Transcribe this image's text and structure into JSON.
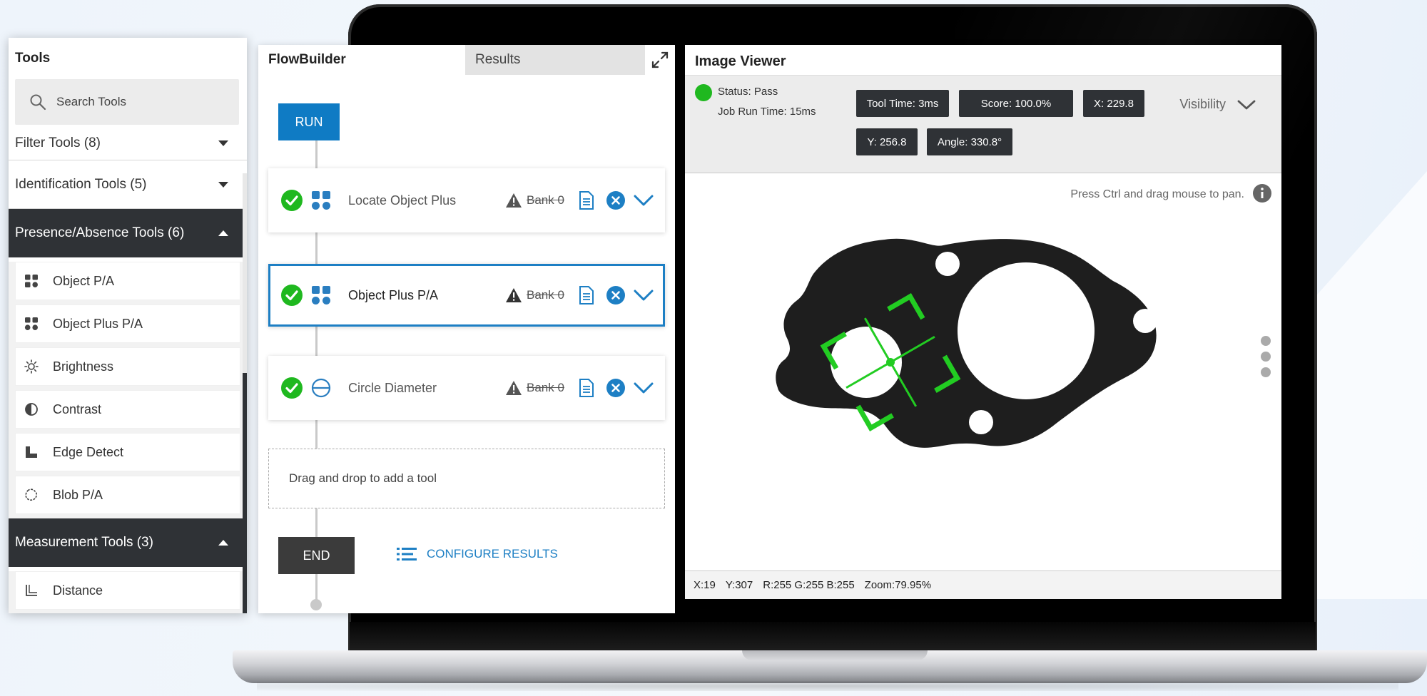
{
  "tools_panel": {
    "title": "Tools",
    "search_placeholder": "Search Tools",
    "categories": [
      {
        "label": "Filter Tools (8)"
      },
      {
        "label": "Identification Tools (5)"
      },
      {
        "label": "Presence/Absence Tools (6)"
      },
      {
        "label": "Measurement Tools (3)"
      }
    ],
    "presence_items": [
      {
        "label": "Object P/A",
        "icon": "grid-icon"
      },
      {
        "label": "Object Plus P/A",
        "icon": "grid-icon"
      },
      {
        "label": "Brightness",
        "icon": "sun-icon"
      },
      {
        "label": "Contrast",
        "icon": "half-circle-icon"
      },
      {
        "label": "Edge Detect",
        "icon": "edge-icon"
      },
      {
        "label": "Blob P/A",
        "icon": "blob-icon"
      }
    ],
    "measurement_items": [
      {
        "label": "Distance",
        "icon": "distance-icon"
      }
    ]
  },
  "flow_panel": {
    "tabs": [
      {
        "label": "FlowBuilder"
      },
      {
        "label": "Results"
      }
    ],
    "run_label": "RUN",
    "end_label": "END",
    "configure_label": "CONFIGURE RESULTS",
    "drop_label": "Drag and drop to add a tool",
    "cards": [
      {
        "name": "Locate Object Plus",
        "bank": "Bank 0"
      },
      {
        "name": "Object Plus P/A",
        "bank": "Bank 0"
      },
      {
        "name": "Circle Diameter",
        "bank": "Bank 0"
      }
    ]
  },
  "viewer": {
    "title": "Image Viewer",
    "status": "Status:  Pass",
    "job_run_time": "Job Run Time:  15ms",
    "badges": {
      "tool_time": "Tool Time:  3ms",
      "score": "Score:  100.0%",
      "x": "X:  229.8",
      "y": "Y:  256.8",
      "angle": "Angle:  330.8°"
    },
    "visibility_label": "Visibility",
    "pan_hint": "Press Ctrl and drag mouse to pan.",
    "statusbar": {
      "x": "X:19",
      "y": "Y:307",
      "rgb": "R:255  G:255  B:255",
      "zoom": "Zoom:79.95%"
    }
  },
  "colors": {
    "accent_blue": "#1d7fc4",
    "pass_green": "#1fb81f",
    "dark_header": "#2f3236",
    "overlay_green": "#22cc22"
  }
}
